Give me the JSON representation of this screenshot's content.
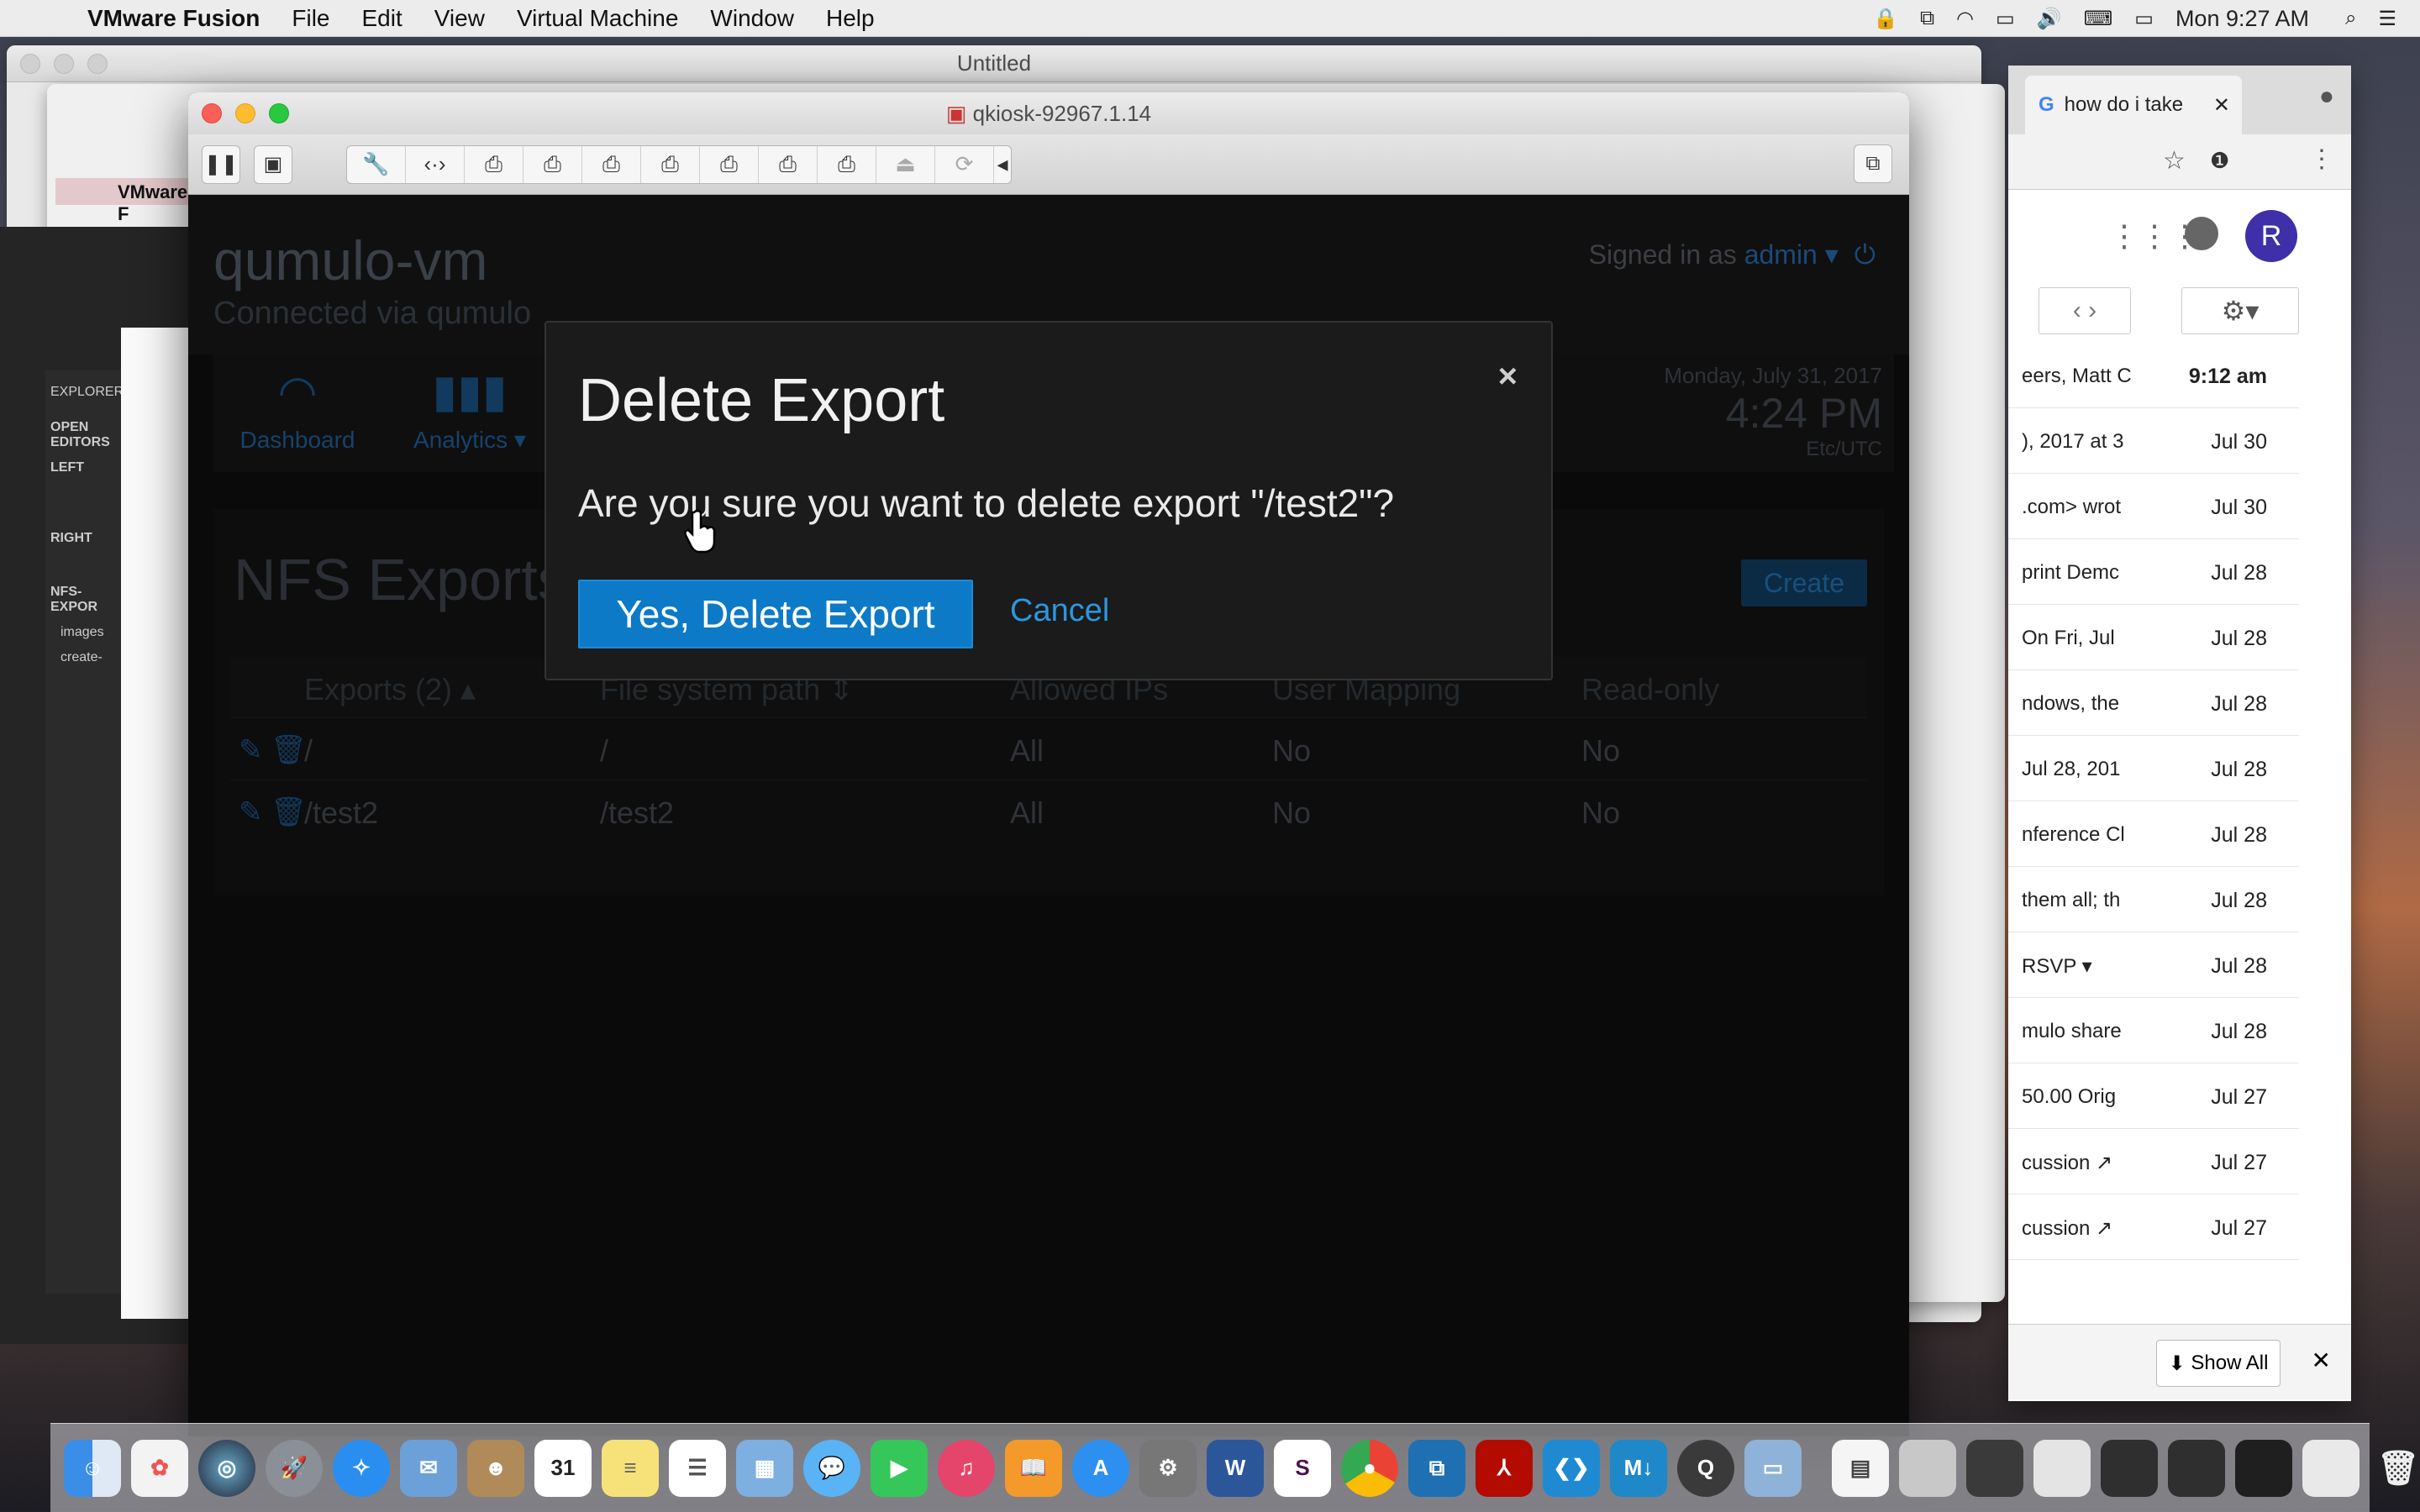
{
  "menubar": {
    "app_name": "VMware Fusion",
    "menus": [
      "File",
      "Edit",
      "View",
      "Virtual Machine",
      "Window",
      "Help"
    ],
    "clock": "Mon 9:27 AM"
  },
  "bg_window": {
    "title": "Untitled",
    "menu_app": "VMware F",
    "explorer_label": "EXPLORER",
    "open_editors": "OPEN EDITORS",
    "left": "LEFT",
    "right": "RIGHT",
    "nfs_export": "NFS-EXPOR",
    "images": "images",
    "create": "create-"
  },
  "vm_window": {
    "title": "qkiosk-92967.1.14"
  },
  "app": {
    "title": "qumulo-vm",
    "subtitle": "Connected via qumulo",
    "signed_in_prefix": "Signed in as",
    "user": "admin",
    "nav": {
      "dashboard": "Dashboard",
      "analytics": "Analytics"
    },
    "date": "Monday, July 31, 2017",
    "time": "4:24 PM",
    "tz": "Etc/UTC",
    "page_title": "NFS Exports",
    "create_label": "Create",
    "table": {
      "headers": [
        "Exports (2)",
        "File system path",
        "Allowed IPs",
        "User Mapping",
        "Read-only"
      ],
      "rows": [
        {
          "export": "/",
          "path": "/",
          "ips": "All",
          "mapping": "No",
          "readonly": "No"
        },
        {
          "export": "/test2",
          "path": "/test2",
          "ips": "All",
          "mapping": "No",
          "readonly": "No"
        }
      ]
    }
  },
  "modal": {
    "title": "Delete Export",
    "body": "Are you sure you want to delete export \"/test2\"?",
    "confirm": "Yes, Delete Export",
    "cancel": "Cancel",
    "close": "×"
  },
  "gmail": {
    "tab_title": "how do i take",
    "avatar": "R",
    "first_time": "9:12 am",
    "rows": [
      {
        "snippet": "eers, Matt C",
        "date": "9:12 am"
      },
      {
        "snippet": "), 2017 at 3",
        "date": "Jul 30"
      },
      {
        "snippet": ".com> wrot",
        "date": "Jul 30"
      },
      {
        "snippet": "print Demc",
        "date": "Jul 28"
      },
      {
        "snippet": "On Fri, Jul",
        "date": "Jul 28"
      },
      {
        "snippet": "ndows, the",
        "date": "Jul 28"
      },
      {
        "snippet": "Jul 28, 201",
        "date": "Jul 28"
      },
      {
        "snippet": "nference Cl",
        "date": "Jul 28"
      },
      {
        "snippet": "them all; th",
        "date": "Jul 28"
      },
      {
        "snippet": "RSVP ▾",
        "date": "Jul 28"
      },
      {
        "snippet": "mulo share",
        "date": "Jul 28"
      },
      {
        "snippet": "50.00 Orig",
        "date": "Jul 27"
      },
      {
        "snippet": "cussion ↗",
        "date": "Jul 27"
      },
      {
        "snippet": "cussion ↗",
        "date": "Jul 27"
      }
    ],
    "show_all": "Show All"
  },
  "colors": {
    "accent": "#0d7ac7",
    "link": "#2c97e0",
    "modal_bg": "#1b1b1b"
  }
}
